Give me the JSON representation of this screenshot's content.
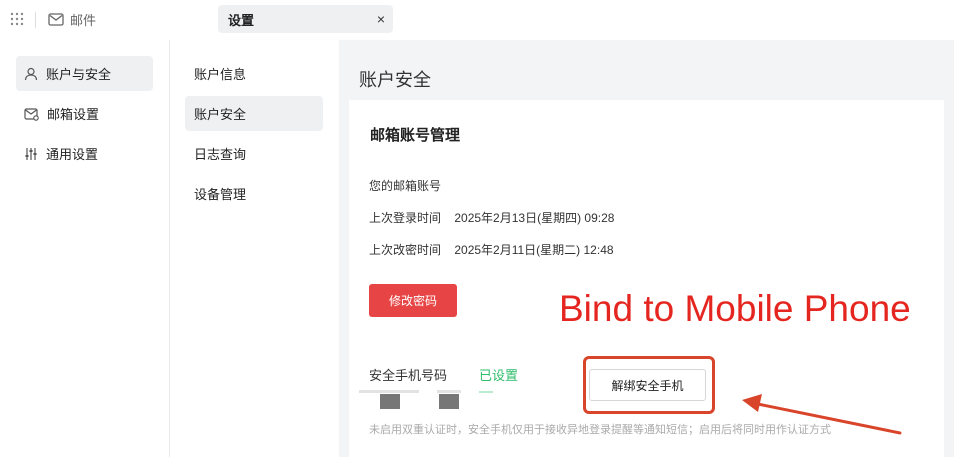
{
  "topbar": {
    "mail_label": "邮件",
    "tab_label": "设置",
    "close_symbol": "×"
  },
  "sidebar": {
    "items": [
      {
        "label": "账户与安全",
        "icon": "user-icon",
        "active": true
      },
      {
        "label": "邮箱设置",
        "icon": "mailbox-settings-icon",
        "active": false
      },
      {
        "label": "通用设置",
        "icon": "sliders-icon",
        "active": false
      }
    ]
  },
  "subnav": {
    "items": [
      {
        "label": "账户信息",
        "active": false
      },
      {
        "label": "账户安全",
        "active": true
      },
      {
        "label": "日志查询",
        "active": false
      },
      {
        "label": "设备管理",
        "active": false
      }
    ]
  },
  "main": {
    "page_title": "账户安全",
    "section_title": "邮箱账号管理",
    "email_label": "您的邮箱账号",
    "email_value": "",
    "last_login_label": "上次登录时间",
    "last_login_value": "2025年2月13日(星期四) 09:28",
    "last_pw_change_label": "上次改密时间",
    "last_pw_change_value": "2025年2月11日(星期二) 12:48",
    "change_password_button": "修改密码",
    "security_phone_label": "安全手机号码",
    "security_phone_status": "已设置",
    "unbind_button": "解绑安全手机",
    "note": "未启用双重认证时，安全手机仅用于接收异地登录提醒等通知短信；启用后将同时用作认证方式"
  },
  "annotation": {
    "text": "Bind to Mobile Phone",
    "color": "#e5251f"
  },
  "colors": {
    "accent_red": "#e74545",
    "status_green": "#2ebd6b",
    "annotation_red": "#d9452b"
  }
}
